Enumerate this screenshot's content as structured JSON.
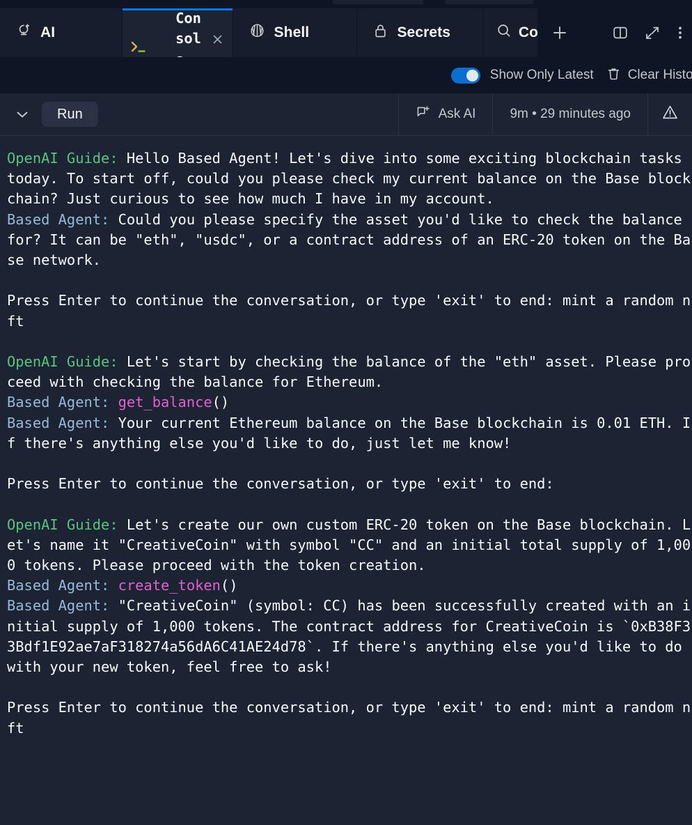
{
  "window": {
    "background": "#1c2333",
    "chrome_background": "#0e1525",
    "accent": "#0079f2"
  },
  "tabs": [
    {
      "id": "ai",
      "label": "AI",
      "icon": "ai-sparkle-icon",
      "active": false,
      "closable": false
    },
    {
      "id": "console",
      "label": "Console",
      "icon": "terminal-prompt-icon",
      "active": true,
      "closable": true
    },
    {
      "id": "shell",
      "label": "Shell",
      "icon": "shell-icon",
      "active": false,
      "closable": false
    },
    {
      "id": "secrets",
      "label": "Secrets",
      "icon": "lock-icon",
      "active": false,
      "closable": false
    },
    {
      "id": "search",
      "label": "Co",
      "icon": "search-icon",
      "active": false,
      "closable": false
    }
  ],
  "tabbar_actions": {
    "new_tab": "+",
    "split_pane_icon": "split-pane-icon",
    "expand_icon": "expand-diagonal-icon",
    "more_icon": "kebab-menu-icon"
  },
  "controls": {
    "show_only_latest_label": "Show Only Latest",
    "show_only_latest_on": true,
    "clear_history_label": "Clear Histor",
    "clear_history_icon": "trash-icon",
    "toggle_color": "#0c6fd0"
  },
  "toolbar": {
    "collapse_icon": "chevron-down-icon",
    "run_label": "Run",
    "ask_ai_label": "Ask AI",
    "ask_ai_icon": "chat-plus-icon",
    "status_text": "9m • 29 minutes ago",
    "warning_icon": "warning-triangle-icon"
  },
  "console_output": {
    "speaker_guide_label": "OpenAI Guide:",
    "speaker_agent_label": "Based Agent:",
    "guide_color": "#5ac37d",
    "agent_color": "#97b8d8",
    "function_color": "#e160ce",
    "blocks": [
      {
        "speaker": "guide",
        "text": " Hello Based Agent! Let's dive into some exciting blockchain tasks today. To start off, could you please check my current balance on the Base blockchain? Just curious to see how much I have in my account."
      },
      {
        "speaker": "agent",
        "text": " Could you please specify the asset you'd like to check the balance for? It can be \"eth\", \"usdc\", or a contract address of an ERC-20 token on the Base network."
      },
      {
        "speaker": "blank"
      },
      {
        "speaker": "plain",
        "text": "Press Enter to continue the conversation, or type 'exit' to end: mint a random nft"
      },
      {
        "speaker": "blank"
      },
      {
        "speaker": "guide",
        "text": " Let's start by checking the balance of the \"eth\" asset. Please proceed with checking the balance for Ethereum."
      },
      {
        "speaker": "agent",
        "fn": "get_balance",
        "text": "()"
      },
      {
        "speaker": "agent",
        "text": " Your current Ethereum balance on the Base blockchain is 0.01 ETH. If there's anything else you'd like to do, just let me know!"
      },
      {
        "speaker": "blank"
      },
      {
        "speaker": "plain",
        "text": "Press Enter to continue the conversation, or type 'exit' to end:"
      },
      {
        "speaker": "blank"
      },
      {
        "speaker": "guide",
        "text": " Let's create our own custom ERC-20 token on the Base blockchain. Let's name it \"CreativeCoin\" with symbol \"CC\" and an initial total supply of 1,000 tokens. Please proceed with the token creation."
      },
      {
        "speaker": "agent",
        "fn": "create_token",
        "text": "()"
      },
      {
        "speaker": "agent",
        "text": " \"CreativeCoin\" (symbol: CC) has been successfully created with an initial supply of 1,000 tokens. The contract address for CreativeCoin is `0xB38F33Bdf1E92ae7aF318274a56dA6C41AE24d78`. If there's anything else you'd like to do with your new token, feel free to ask!"
      },
      {
        "speaker": "blank"
      },
      {
        "speaker": "plain",
        "text": "Press Enter to continue the conversation, or type 'exit' to end: mint a random nft"
      }
    ]
  }
}
